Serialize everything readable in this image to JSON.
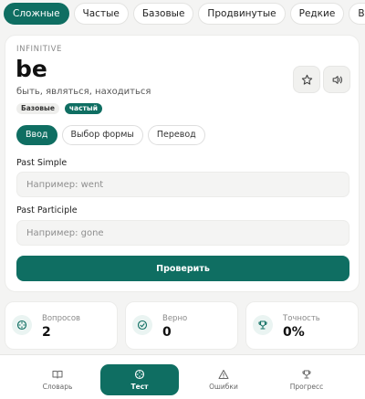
{
  "filters": [
    "Сложные",
    "Частые",
    "Базовые",
    "Продвинутые",
    "Редкие",
    "Все"
  ],
  "card": {
    "form_type": "INFINITIVE",
    "verb": "be",
    "translation": "быть, являться, находиться",
    "tags": [
      "Базовые",
      "частый"
    ]
  },
  "modes": [
    "Ввод",
    "Выбор формы",
    "Перевод"
  ],
  "past_simple": {
    "label": "Past Simple",
    "placeholder": "Например: went"
  },
  "past_participle": {
    "label": "Past Participle",
    "placeholder": "Например: gone"
  },
  "check_label": "Проверить",
  "stats": [
    {
      "label": "Вопросов",
      "value": "2",
      "icon": "target-icon"
    },
    {
      "label": "Верно",
      "value": "0",
      "icon": "check-circle-icon"
    },
    {
      "label": "Точность",
      "value": "0%",
      "icon": "trophy-icon"
    }
  ],
  "nav": [
    "Словарь",
    "Тест",
    "Ошибки",
    "Прогресс"
  ],
  "colors": {
    "accent": "#0f6e62",
    "background": "#f4f4f3"
  }
}
